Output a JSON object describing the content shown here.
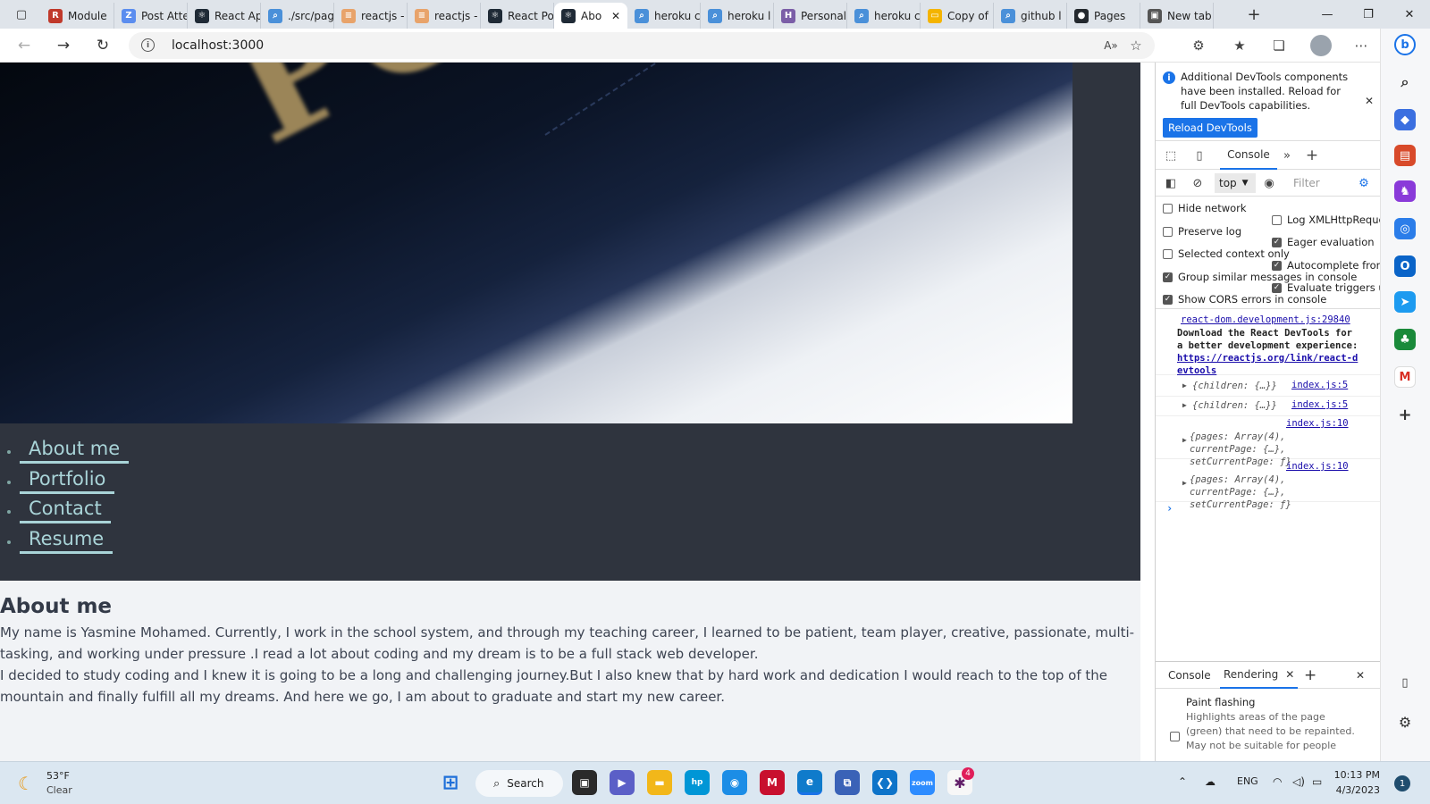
{
  "browser": {
    "tabs": [
      {
        "label": "Module",
        "icon": "letter-r-icon",
        "color": "#c0392b",
        "glyph": "R"
      },
      {
        "label": "Post Atte",
        "icon": "zoom-icon",
        "color": "#5b8def",
        "glyph": "Z"
      },
      {
        "label": "React Ap",
        "icon": "react-icon",
        "color": "#1f2a36",
        "glyph": "⚛"
      },
      {
        "label": "./src/pag",
        "icon": "search-icon",
        "color": "#4a90d9",
        "glyph": "⌕"
      },
      {
        "label": "reactjs -",
        "icon": "stackoverflow-icon",
        "color": "#e8a36a",
        "glyph": "≡"
      },
      {
        "label": "reactjs -",
        "icon": "stackoverflow-icon",
        "color": "#e8a36a",
        "glyph": "≡"
      },
      {
        "label": "React Po",
        "icon": "react-icon",
        "color": "#1f2a36",
        "glyph": "⚛"
      },
      {
        "label": "Abo",
        "icon": "react-icon",
        "color": "#1f2a36",
        "glyph": "⚛",
        "active": true
      },
      {
        "label": "heroku c",
        "icon": "search-icon",
        "color": "#4a90d9",
        "glyph": "⌕"
      },
      {
        "label": "heroku l",
        "icon": "search-icon",
        "color": "#4a90d9",
        "glyph": "⌕"
      },
      {
        "label": "Personal",
        "icon": "heroku-icon",
        "color": "#7b5ea7",
        "glyph": "H"
      },
      {
        "label": "heroku c",
        "icon": "search-icon",
        "color": "#4a90d9",
        "glyph": "⌕"
      },
      {
        "label": "Copy of",
        "icon": "slides-icon",
        "color": "#f4b400",
        "glyph": "▭"
      },
      {
        "label": "github l",
        "icon": "search-icon",
        "color": "#4a90d9",
        "glyph": "⌕"
      },
      {
        "label": "Pages",
        "icon": "github-icon",
        "color": "#24292e",
        "glyph": "●"
      },
      {
        "label": "New tab",
        "icon": "newtab-icon",
        "color": "#555555",
        "glyph": "▣"
      }
    ],
    "url": "localhost:3000",
    "accent": "#1a73e8"
  },
  "page": {
    "hero_text": "POR",
    "nav": [
      "About me",
      "Portfolio",
      "Contact",
      "Resume"
    ],
    "about": {
      "title": "About me",
      "paragraph1": "My name is Yasmine Mohamed. Currently, I work in the school system, and through my teaching career, I learned to be patient, team player, creative, passionate, multi-tasking, and working under pressure .I read a lot about coding and my dream is to be a full stack web developer.",
      "paragraph2": "I decided to study coding and I knew it is going to be a long and challenging journey.But I also knew that by hard work and dedication I would reach to the top of the mountain and finally fulfill all my dreams. And here we go, I am about to graduate and start my new career."
    },
    "colors": {
      "nav_bg": "#2f343e",
      "link": "#a9d4d8",
      "body_bg": "#f1f3f6"
    }
  },
  "devtools": {
    "info": "Additional DevTools components have been installed. Reload for full DevTools capabilities.",
    "reload_button": "Reload DevTools",
    "console_tab": "Console",
    "context": "top",
    "filter_placeholder": "Filter",
    "options_left": [
      {
        "label": "Hide network",
        "checked": false
      },
      {
        "label": "Preserve log",
        "checked": false
      },
      {
        "label": "Selected context only",
        "checked": false
      },
      {
        "label": "Group similar messages in console",
        "checked": true
      },
      {
        "label": "Show CORS errors in console",
        "checked": true
      }
    ],
    "options_right": [
      {
        "label": "Log XMLHttpRequests",
        "checked": false
      },
      {
        "label": "Eager evaluation",
        "checked": true
      },
      {
        "label": "Autocomplete from history",
        "checked": true
      },
      {
        "label": "Evaluate triggers user activation",
        "checked": true
      }
    ],
    "logs": {
      "entry1_src": "react-dom.development.js:29840",
      "entry1_msg": "Download the React DevTools for a better development experience: ",
      "entry1_link": "https://reactjs.org/link/react-devtools",
      "entry2_obj": "{children: {…}}",
      "entry2_src": "index.js:5",
      "entry3_obj": "{children: {…}}",
      "entry3_src": "index.js:5",
      "entry4_src": "index.js:10",
      "entry4_obj": "{pages: Array(4), currentPage: {…}, setCurrentPage: ƒ}",
      "entry5_src": "index.js:10",
      "entry5_obj": "{pages: Array(4), currentPage: {…}, setCurrentPage: ƒ}"
    },
    "drawer": {
      "tab1": "Console",
      "tab2": "Rendering",
      "paint_title": "Paint flashing",
      "paint_desc": "Highlights areas of the page (green) that need to be repainted. May not be suitable for people"
    }
  },
  "taskbar": {
    "temp": "53°F",
    "weather": "Clear",
    "search": "Search",
    "lang": "ENG",
    "time": "10:13 PM",
    "date": "4/3/2023",
    "notifications": "1",
    "slack_badge": "4"
  }
}
